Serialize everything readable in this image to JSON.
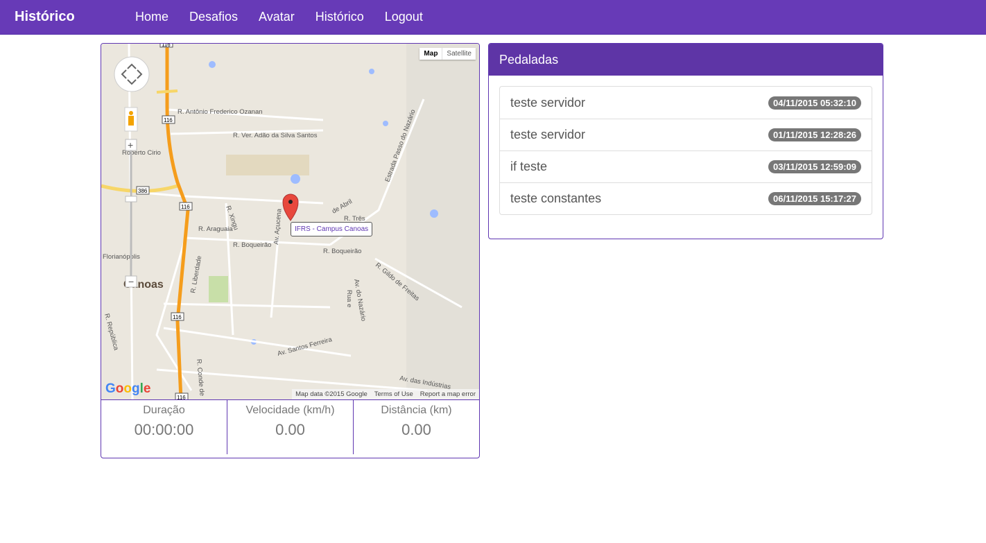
{
  "nav": {
    "brand": "Histórico",
    "links": [
      "Home",
      "Desafios",
      "Avatar",
      "Histórico",
      "Logout"
    ]
  },
  "map": {
    "type_buttons": [
      "Map",
      "Satellite"
    ],
    "attribution": [
      "Map data ©2015 Google",
      "Terms of Use",
      "Report a map error"
    ],
    "logo": "Google",
    "marker_label": "IFRS - Campus Canoas",
    "city_label": "Canoas",
    "street_labels": [
      "R. Antônio Frederico Ozanan",
      "R. Ver. Adão da Silva Santos",
      "R. Araguaia",
      "R. Xingu",
      "Av. Açucena",
      "R. Boqueirão",
      "R. Boqueirão",
      "Florianópolis",
      "R. Liberdade",
      "Estrada Passo do Nazário",
      "R. Gildo de Freitas",
      "Av. do Nazário",
      "Av. Santos Ferreira",
      "Av. das Indústrias",
      "R. Conde de",
      "Rua e",
      "R. República",
      "R. Três",
      "de Abril",
      "Roberto Cirio"
    ],
    "highway_shields": [
      "116",
      "116",
      "116",
      "116",
      "116",
      "386"
    ],
    "colors": {
      "land": "#ebe7de",
      "highway": "#f59d1c",
      "water": "#9ebcff",
      "marker": "#e8483d"
    }
  },
  "stats": [
    {
      "label": "Duração",
      "value": "00:00:00"
    },
    {
      "label": "Velocidade (km/h)",
      "value": "0.00"
    },
    {
      "label": "Distância (km)",
      "value": "0.00"
    }
  ],
  "panel": {
    "title": "Pedaladas",
    "items": [
      {
        "name": "teste servidor",
        "date": "04/11/2015 05:32:10"
      },
      {
        "name": "teste servidor",
        "date": "01/11/2015 12:28:26"
      },
      {
        "name": "if teste",
        "date": "03/11/2015 12:59:09"
      },
      {
        "name": "teste constantes",
        "date": "06/11/2015 15:17:27"
      }
    ]
  },
  "colors": {
    "primary": "#673ab7",
    "badge": "#777777"
  }
}
